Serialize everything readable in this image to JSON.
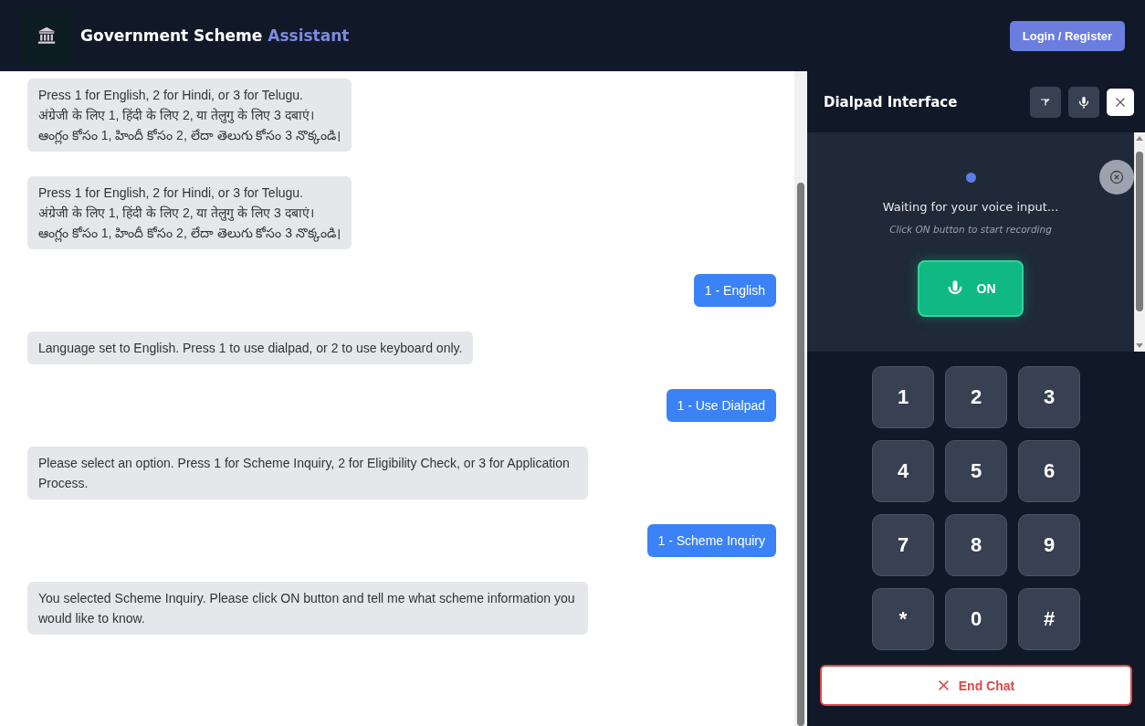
{
  "header": {
    "title": "Government Scheme",
    "title_accent": "Assistant",
    "login_button": "Login / Register"
  },
  "messages": [
    {
      "kind": "bot",
      "lines": [
        "Press 1 for English, 2 for Hindi, or 3 for Telugu.",
        "अंग्रेजी के लिए 1, हिंदी के लिए 2, या तेलुगु के लिए 3 दबाएं।",
        "ఆంగ్లం కోసం 1, హిందీ కోసం 2, లేదా తెలుగు కోసం 3 నొక్కండి।"
      ]
    },
    {
      "kind": "bot",
      "lines": [
        "Press 1 for English, 2 for Hindi, or 3 for Telugu.",
        "अंग्रेजी के लिए 1, हिंदी के लिए 2, या तेलुगु के लिए 3 दबाएं।",
        "ఆంగ్లం కోసం 1, హిందీ కోసం 2, లేదా తెలుగు కోసం 3 నొక్కండి।"
      ]
    },
    {
      "kind": "user",
      "lines": [
        "1 - English"
      ]
    },
    {
      "kind": "bot",
      "lines": [
        "Language set to English. Press 1 to use dialpad, or 2 to use keyboard only."
      ]
    },
    {
      "kind": "user",
      "lines": [
        "1 - Use Dialpad"
      ]
    },
    {
      "kind": "bot",
      "lines": [
        "Please select an option. Press 1 for Scheme Inquiry, 2 for Eligibility Check, or 3 for Application Process."
      ]
    },
    {
      "kind": "user",
      "lines": [
        "1 - Scheme Inquiry"
      ]
    },
    {
      "kind": "bot",
      "lines": [
        "You selected Scheme Inquiry. Please click ON button and tell me what scheme information you would like to know."
      ]
    }
  ],
  "dialpad": {
    "title": "Dialpad Interface",
    "status": "Waiting for your voice input...",
    "hint": "Click ON button to start recording",
    "on_button": "ON",
    "keys": [
      "1",
      "2",
      "3",
      "4",
      "5",
      "6",
      "7",
      "8",
      "9",
      "*",
      "0",
      "#"
    ],
    "end_button": "End Chat"
  }
}
